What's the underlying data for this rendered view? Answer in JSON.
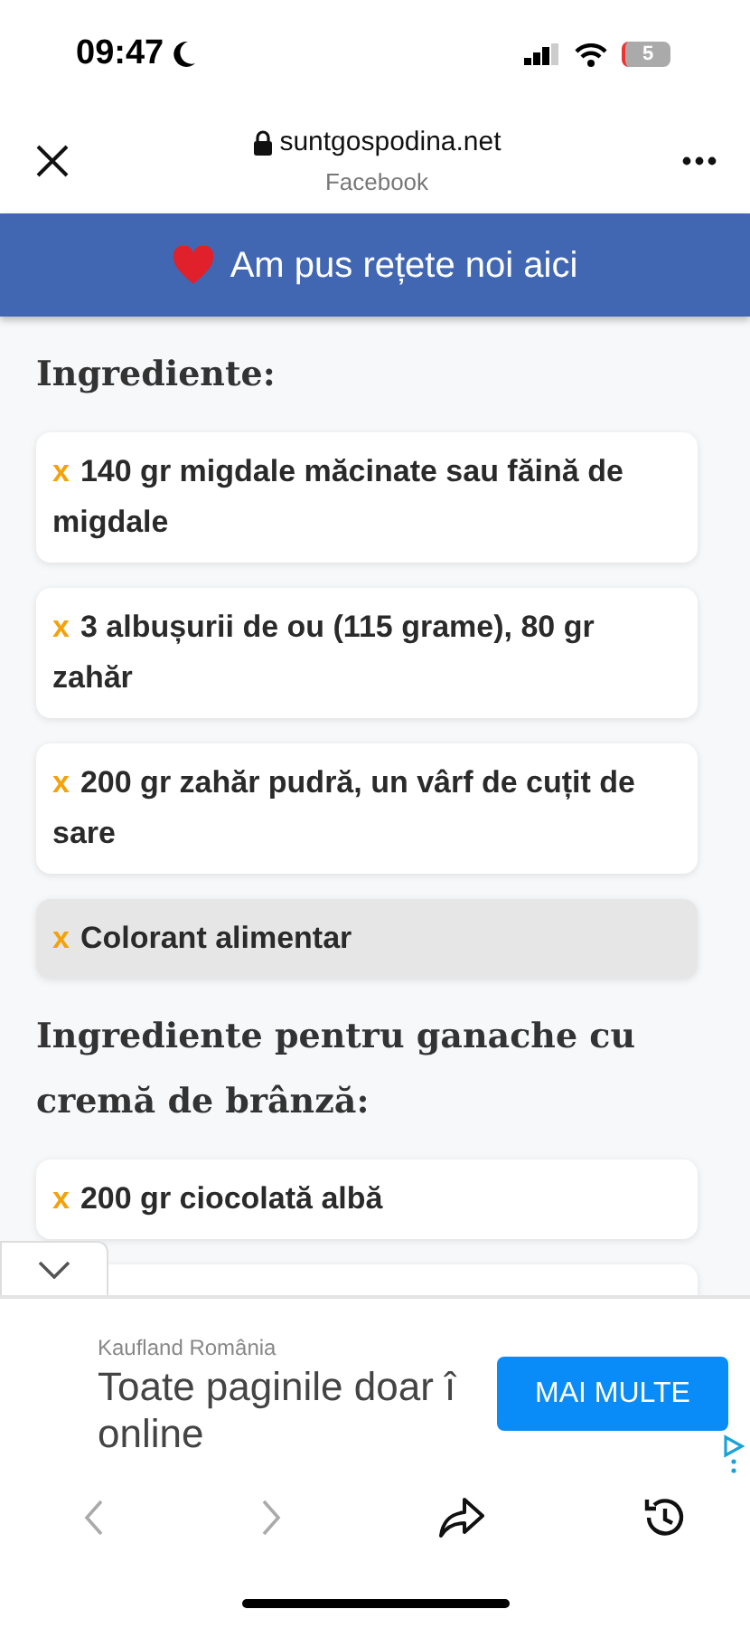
{
  "status_bar": {
    "time": "09:47",
    "battery": "5"
  },
  "browser_header": {
    "domain": "suntgospodina.net",
    "source": "Facebook"
  },
  "banner": {
    "text": "Am pus rețete noi aici"
  },
  "sections": [
    {
      "heading": "Ingrediente:",
      "items": [
        {
          "bullet": "x",
          "text": "140 gr migdale măcinate sau făină de migdale",
          "highlighted": false
        },
        {
          "bullet": "x",
          "text": "3 albușurii de ou (115 grame), 80 gr zahăr",
          "highlighted": false
        },
        {
          "bullet": "x",
          "text": "200 gr zahăr pudră, un vârf de cuțit de sare",
          "highlighted": false
        },
        {
          "bullet": "x",
          "text": "Colorant alimentar",
          "highlighted": true
        }
      ]
    },
    {
      "heading": "Ingrediente pentru ganache cu cremă de brânză:",
      "items": [
        {
          "bullet": "x",
          "text": "200 gr ciocolată albă",
          "highlighted": false
        }
      ]
    }
  ],
  "ad": {
    "advertiser": "Kaufland România",
    "headline_lines": [
      "Toate paginile doar î",
      "online"
    ],
    "button": "MAI MULTE"
  }
}
